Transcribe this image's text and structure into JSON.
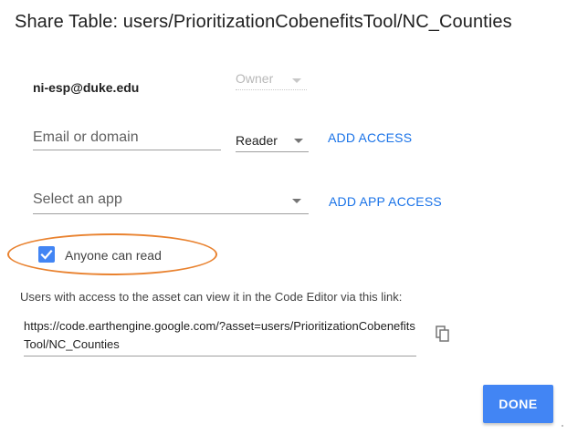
{
  "dialog": {
    "title": "Share Table: users/PrioritizationCobenefitsTool/NC_Counties"
  },
  "owner_row": {
    "email": "ni-esp@duke.edu",
    "role": "Owner"
  },
  "add_access": {
    "email_placeholder": "Email or domain",
    "email_value": "",
    "role": "Reader",
    "button_label": "ADD ACCESS"
  },
  "app_access": {
    "placeholder": "Select an app",
    "button_label": "ADD APP ACCESS"
  },
  "public": {
    "label": "Anyone can read",
    "checked": true
  },
  "link": {
    "info": "Users with access to the asset can view it in the Code Editor via this link:",
    "url": "https://code.earthengine.google.com/?asset=users/PrioritizationCobenefitsTool/NC_Counties"
  },
  "footer": {
    "done_label": "DONE"
  },
  "colors": {
    "accent": "#4285f4",
    "link": "#1a73e8",
    "highlight": "#e9822f"
  },
  "icons": {
    "copy": "copy-icon",
    "checkbox": "check-icon",
    "dropdown": "chevron-down-icon"
  }
}
